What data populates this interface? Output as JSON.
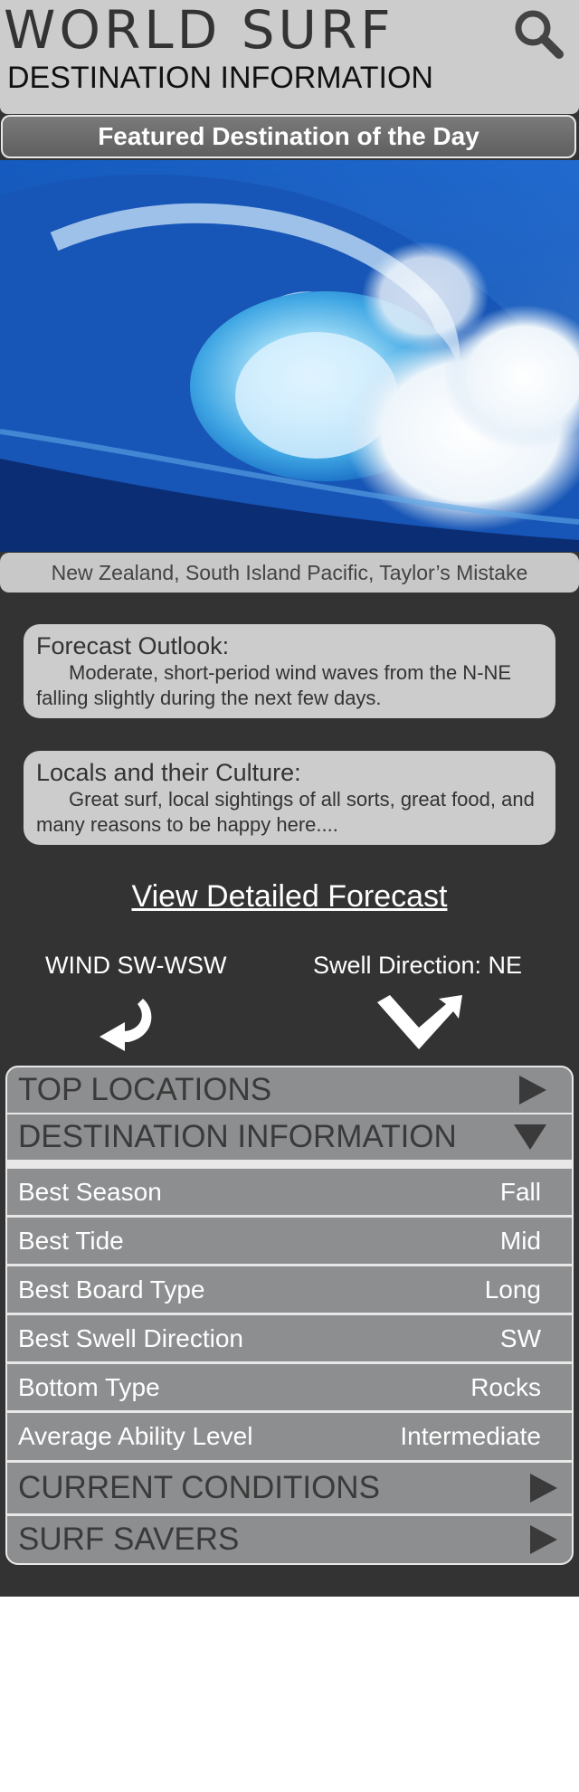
{
  "header": {
    "brand": "WORLD SURF",
    "subtitle": "DESTINATION INFORMATION",
    "search_icon": "search-icon"
  },
  "featured": {
    "heading": "Featured Destination of the Day",
    "image": "curling-blue-wave-photo",
    "caption": "New Zealand, South Island Pacific, Taylor’s Mistake"
  },
  "cards": {
    "forecast_title": "Forecast Outlook:",
    "forecast_body": "Moderate, short-period wind waves from the N-NE falling slightly during the next few days.",
    "locals_title": "Locals and their Culture:",
    "locals_body": "Great surf, local sightings of all sorts, great food, and many reasons to be happy here...."
  },
  "detailed_forecast_link": "View Detailed Forecast",
  "conditions": {
    "wind_label": "WIND SW-WSW",
    "swell_label": "Swell Direction: NE",
    "wind_icon": "curved-arrow-icon",
    "swell_icon": "chevron-arrow-icon"
  },
  "accordion": {
    "top_locations": "TOP LOCATIONS",
    "destination_information": "DESTINATION INFORMATION",
    "details": [
      {
        "label": "Best Season",
        "value": "Fall"
      },
      {
        "label": "Best Tide",
        "value": "Mid"
      },
      {
        "label": "Best Board Type",
        "value": "Long"
      },
      {
        "label": "Best Swell Direction",
        "value": "SW"
      },
      {
        "label": "Bottom Type",
        "value": "Rocks"
      },
      {
        "label": "Average Ability Level",
        "value": "Intermediate"
      }
    ],
    "current_conditions": "CURRENT CONDITIONS",
    "surf_savers": "SURF SAVERS"
  },
  "colors": {
    "background": "#333333",
    "header": "#cccccc",
    "row": "#8d8e90",
    "divider": "#e8e8e8"
  }
}
